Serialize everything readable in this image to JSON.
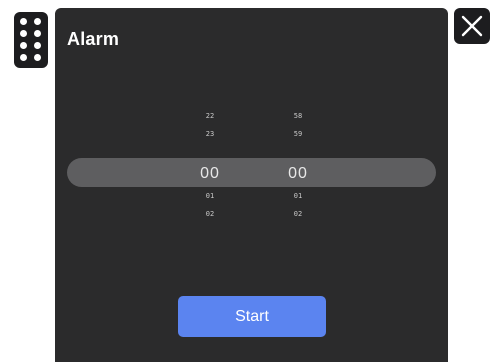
{
  "widget": {
    "title": "Alarm",
    "start_label": "Start"
  },
  "picker": {
    "hours_value": "00",
    "minutes_value": "00",
    "hours_above": [
      "22",
      "23"
    ],
    "hours_below": [
      "01",
      "02"
    ],
    "minutes_above": [
      "58",
      "59"
    ],
    "minutes_below": [
      "01",
      "02"
    ]
  },
  "icons": {
    "drag_handle": "drag-handle-icon",
    "close": "close-icon"
  },
  "colors": {
    "panel_bg": "#2b2b2c",
    "handle_bg": "#1d1d1f",
    "selection_band": "#5e5e60",
    "start_button": "#5b84f0",
    "text": "#ffffff"
  }
}
